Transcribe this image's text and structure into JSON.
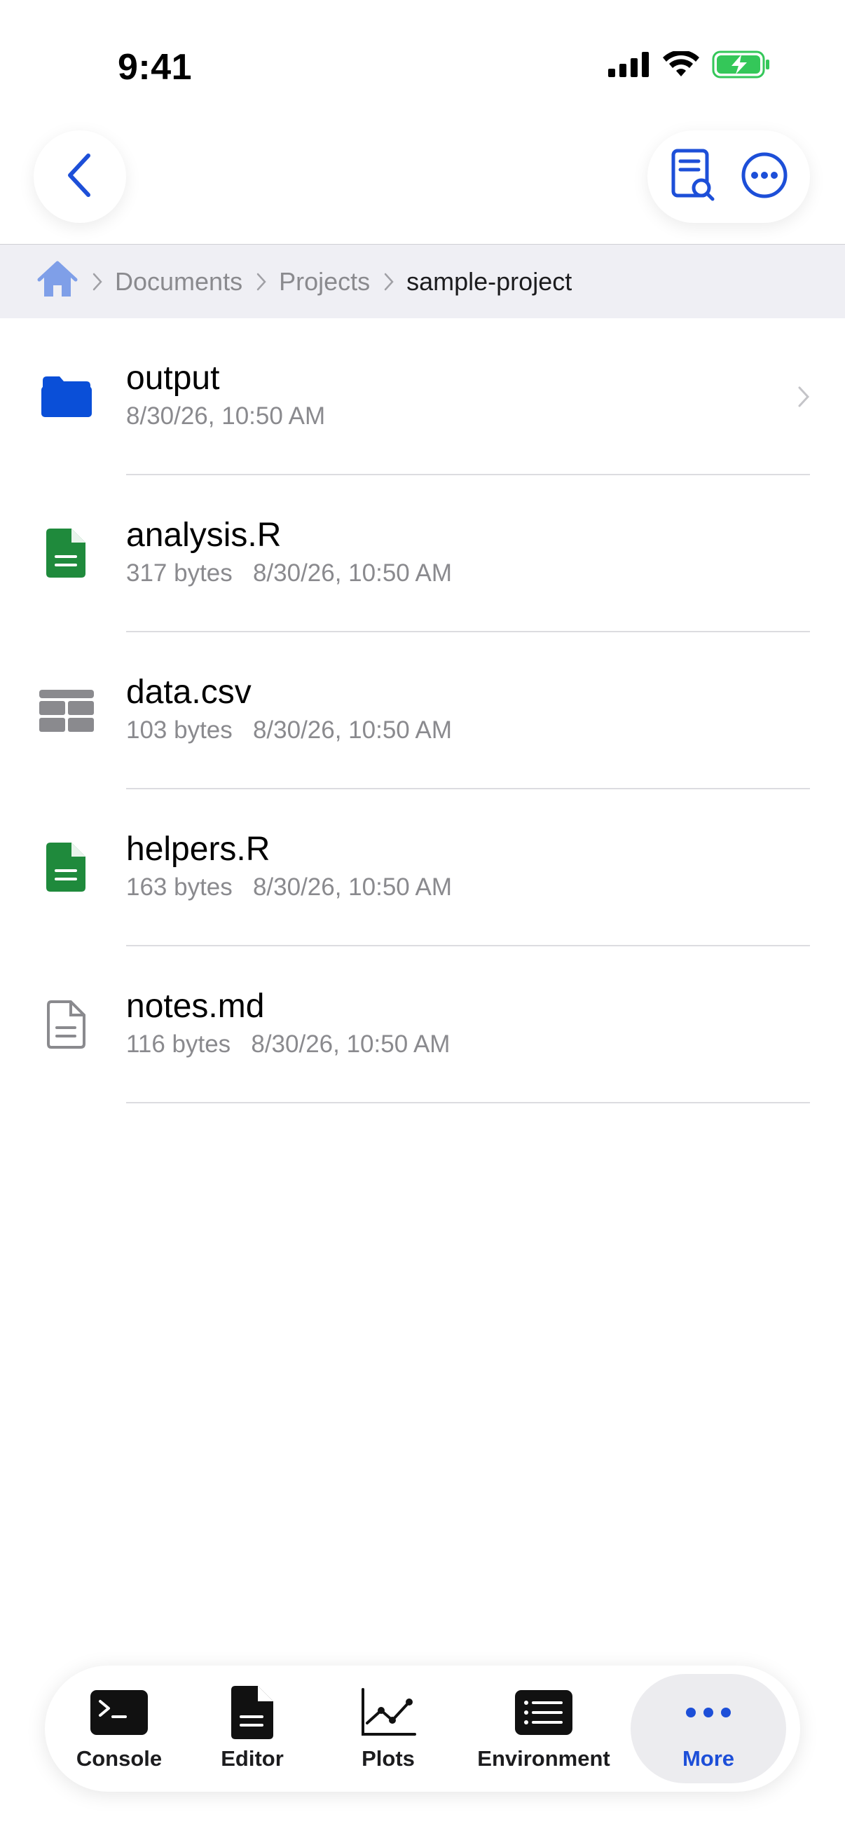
{
  "status_bar": {
    "time": "9:41"
  },
  "breadcrumb": {
    "items": [
      "Documents",
      "Projects",
      "sample-project"
    ]
  },
  "files": [
    {
      "name": "output",
      "meta": "8/30/26, 10:50 AM",
      "icon": "folder-icon"
    },
    {
      "name": "analysis.R",
      "meta": "317 bytes   8/30/26, 10:50 AM",
      "icon": "r-file-icon"
    },
    {
      "name": "data.csv",
      "meta": "103 bytes   8/30/26, 10:50 AM",
      "icon": "table-icon"
    },
    {
      "name": "helpers.R",
      "meta": "163 bytes   8/30/26, 10:50 AM",
      "icon": "r-file-icon"
    },
    {
      "name": "notes.md",
      "meta": "116 bytes   8/30/26, 10:50 AM",
      "icon": "document-icon"
    }
  ],
  "tabs": [
    {
      "label": "Console",
      "icon": "terminal-icon"
    },
    {
      "label": "Editor",
      "icon": "document-icon"
    },
    {
      "label": "Plots",
      "icon": "line-chart-icon"
    },
    {
      "label": "Environment",
      "icon": "list-icon"
    },
    {
      "label": "More",
      "icon": "ellipsis-icon",
      "active": true
    }
  ],
  "colors": {
    "accent": "#1d4fd8",
    "folder": "#0a4fd8",
    "r_file": "#1f8a3c",
    "muted": "#8a8a8e",
    "battery": "#34c759"
  }
}
